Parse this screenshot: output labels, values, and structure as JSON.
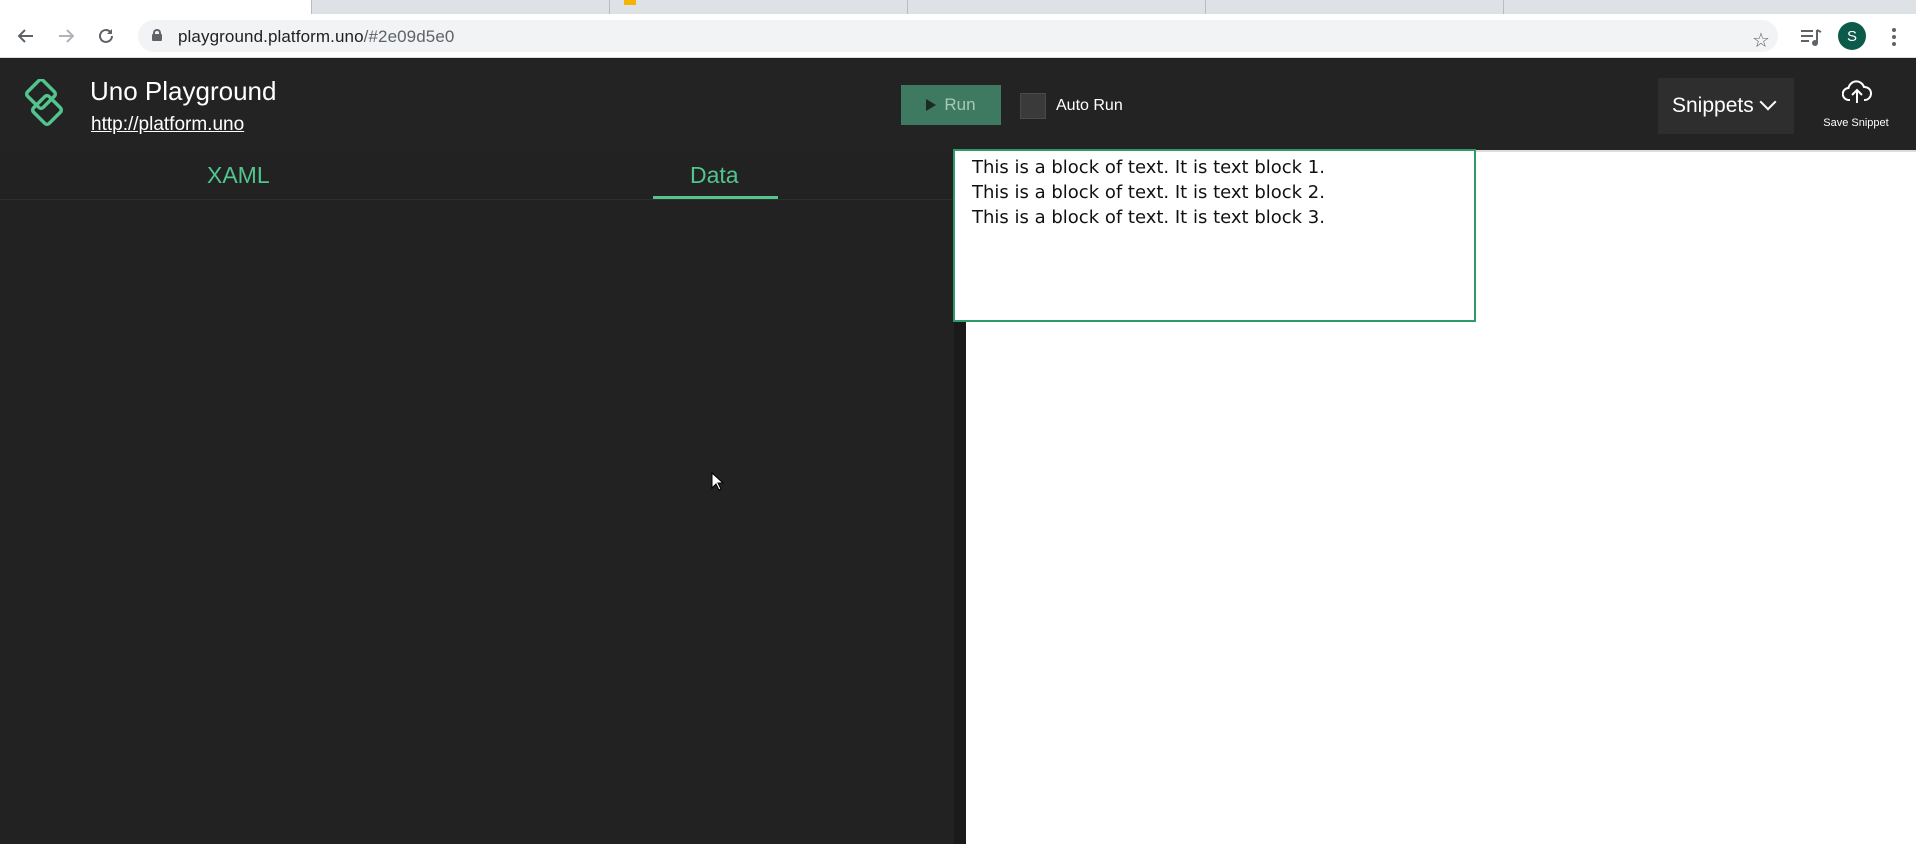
{
  "browser": {
    "url_host": "playground.platform.uno",
    "url_path": "/#2e09d5e0",
    "profile_initial": "S"
  },
  "app": {
    "title": "Uno Playground",
    "link": "http://platform.uno",
    "run_label": "Run",
    "auto_run_label": "Auto Run",
    "snippets_label": "Snippets",
    "save_snippet_label": "Save Snippet",
    "accent_color": "#52c48d"
  },
  "editor": {
    "tabs": [
      {
        "label": "XAML",
        "selected": false
      },
      {
        "label": "Data",
        "selected": true
      }
    ]
  },
  "preview": {
    "text_blocks": [
      "This is a block of text. It is text block 1.",
      "This is a block of text. It is text block 2.",
      "This is a block of text. It is text block 3."
    ]
  }
}
